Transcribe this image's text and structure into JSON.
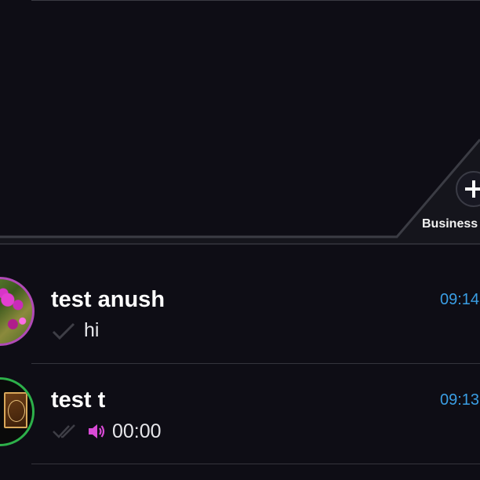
{
  "panel": {
    "business_button_label": "Business",
    "colors": {
      "background": "#0e0d15",
      "frame_line": "#3b3c44",
      "frame_fill": "#1a1a22"
    }
  },
  "chats": [
    {
      "name": "test anush",
      "time": "09:14",
      "status_icon": "single-check-icon",
      "preview": "hi",
      "avatar": "flower-photo",
      "avatar_ring_color": "#b04ab6"
    },
    {
      "name": "test t",
      "time": "09:13",
      "status_icon": "double-check-icon",
      "preview_icon": "speaker-icon",
      "preview": "00:00",
      "avatar": "card-photo",
      "avatar_ring_color": "#2db04a"
    }
  ],
  "colors": {
    "time_accent": "#3a9ee4",
    "speaker_accent": "#d94ad6"
  }
}
